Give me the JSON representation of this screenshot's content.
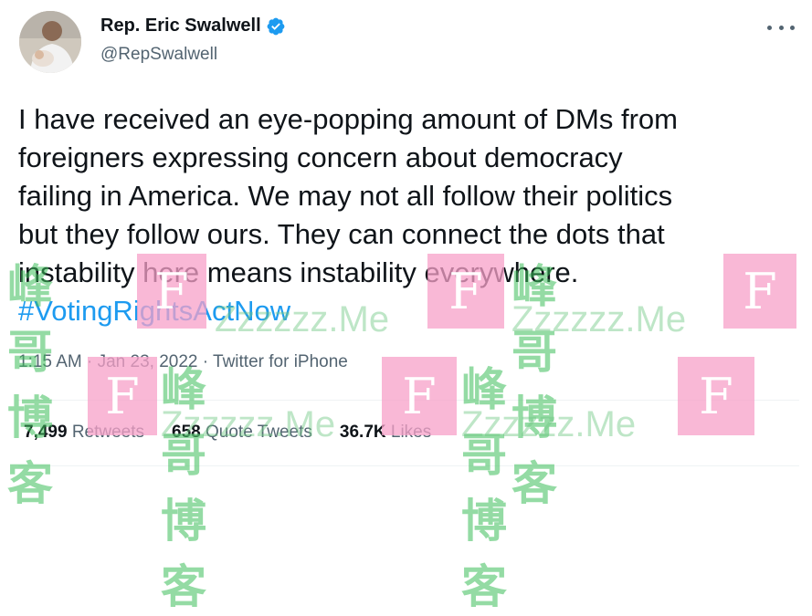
{
  "tweet": {
    "display_name": "Rep. Eric Swalwell",
    "handle": "@RepSwalwell",
    "text_line1": "I have received an eye-popping amount of DMs from",
    "text_line2": "foreigners expressing concern about democracy",
    "text_line3": "failing in America. We may not all follow their politics",
    "text_line4": "but they follow ours. They can connect the dots that",
    "text_line5": "instability here means instability everywhere.",
    "hashtag": "#VotingRightsActNow",
    "time": "1:15 AM",
    "date": "Jan 23, 2022",
    "source": "Twitter for iPhone",
    "dot": "·"
  },
  "stats": {
    "retweets_count": "7,499",
    "retweets_label": "Retweets",
    "quotes_count": "658",
    "quotes_label": "Quote Tweets",
    "likes_count": "36.7K",
    "likes_label": "Likes"
  },
  "watermark": {
    "letter": "F",
    "cn": "峰哥博客",
    "en": "Zzzzzz.Me"
  },
  "colors": {
    "link": "#1d9bf0",
    "secondary_text": "#536471",
    "primary_text": "#0f1419",
    "verified_badge": "#1d9bf0"
  }
}
